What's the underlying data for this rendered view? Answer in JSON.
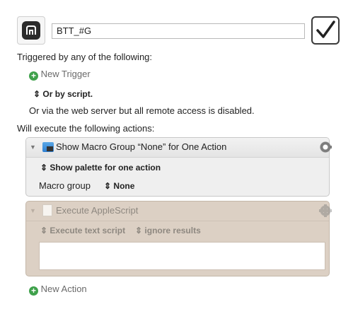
{
  "header": {
    "icon_name": "btt-app-icon",
    "macro_name": "BTT_#G",
    "enabled_checkmark": "✓"
  },
  "triggers": {
    "heading": "Triggered by any of the following:",
    "new_trigger_label": "New Trigger",
    "script_option": "Or by script.",
    "web_server_note": "Or via the web server but all remote access is disabled."
  },
  "actions": {
    "heading": "Will execute the following actions:",
    "items": [
      {
        "title": "Show Macro Group “None” for One Action",
        "mode": "Show palette for one action",
        "field_label": "Macro group",
        "field_value": "None"
      },
      {
        "title": "Execute AppleScript",
        "mode": "Execute text script",
        "result_option": "ignore results",
        "script_text": ""
      }
    ],
    "new_action_label": "New Action"
  },
  "colors": {
    "disabled_action_bg": "#dcd0c4",
    "add_button_green": "#3fa14b"
  }
}
